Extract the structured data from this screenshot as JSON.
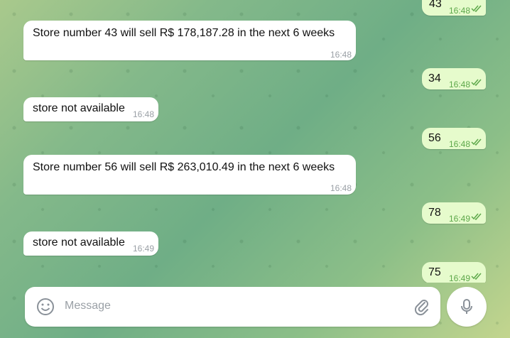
{
  "messages": [
    {
      "text": "43",
      "time": "16:48"
    },
    {
      "text": "Store number 43 will sell R$ 178,187.28 in the next 6 weeks",
      "time": "16:48"
    },
    {
      "text": "34",
      "time": "16:48"
    },
    {
      "text": "store not available",
      "time": "16:48"
    },
    {
      "text": "56",
      "time": "16:48"
    },
    {
      "text": "Store number 56 will sell R$ 263,010.49 in the next 6 weeks",
      "time": "16:48"
    },
    {
      "text": "78",
      "time": "16:49"
    },
    {
      "text": "store not available",
      "time": "16:49"
    },
    {
      "text": "75",
      "time": "16:49"
    }
  ],
  "composer": {
    "placeholder": "Message"
  },
  "icons": {
    "emoji": "smile-icon",
    "attach": "paperclip-icon",
    "mic": "microphone-icon",
    "read": "double-check-icon"
  },
  "colors": {
    "incoming": "#ffffff",
    "outgoing": "#e6fbcc",
    "read_check": "#5da84a"
  }
}
